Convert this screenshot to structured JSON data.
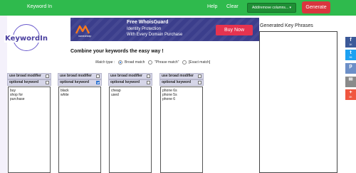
{
  "topbar": {
    "brand": "Keyword In",
    "help": "Help",
    "clear": "Clear",
    "columns_button": "Add/remove columns...",
    "columns_caret": "▾",
    "generate_button": "Generate"
  },
  "logo": {
    "text": "KeywordIn"
  },
  "ad": {
    "logo_name": "namecheap",
    "line1": "Free WhoisGuard",
    "line2": "Identity Protection",
    "line3": "With Every Domain Purchase",
    "button": "Buy Now"
  },
  "main": {
    "headline": "Combine your keywords the easy way !",
    "match_type_label": "Match type :",
    "match_options": [
      {
        "label": "Broad match",
        "selected": true
      },
      {
        "label": "\"Phrase match\"",
        "selected": false
      },
      {
        "label": "[Exact match]",
        "selected": false
      }
    ]
  },
  "columns": [
    {
      "broad_label": "use broad modifier",
      "broad_checked": false,
      "optional_label": "optional keyword",
      "optional_checked": false,
      "lines": [
        "buy",
        "shop for",
        "purchase"
      ]
    },
    {
      "broad_label": "use broad modifier",
      "broad_checked": false,
      "optional_label": "optional keyword",
      "optional_checked": true,
      "lines": [
        "black",
        "white"
      ]
    },
    {
      "broad_label": "use broad modifier",
      "broad_checked": false,
      "optional_label": "optional keyword",
      "optional_checked": false,
      "lines": [
        "cheap",
        "used"
      ]
    },
    {
      "broad_label": "use broad modifier",
      "broad_checked": false,
      "optional_label": "optional keyword",
      "optional_checked": false,
      "lines": [
        "phone 6s",
        "phone 5s",
        "phone 6"
      ]
    }
  ],
  "results": {
    "title": "Generated Key Phrases"
  },
  "share": [
    {
      "icon": "facebook-icon",
      "glyph": "f",
      "count": "1K",
      "color": "#3b5998"
    },
    {
      "icon": "twitter-icon",
      "glyph": "t",
      "count": "96",
      "color": "#1da1f2"
    },
    {
      "icon": "pinterest-icon",
      "glyph": "p",
      "count": "",
      "color": "#6c8fc7"
    },
    {
      "icon": "email-icon",
      "glyph": "✉",
      "count": "",
      "color": "#8a8a8a"
    },
    {
      "icon": "more-icon",
      "glyph": "+",
      "count": "0K",
      "color": "#f0563f"
    }
  ]
}
